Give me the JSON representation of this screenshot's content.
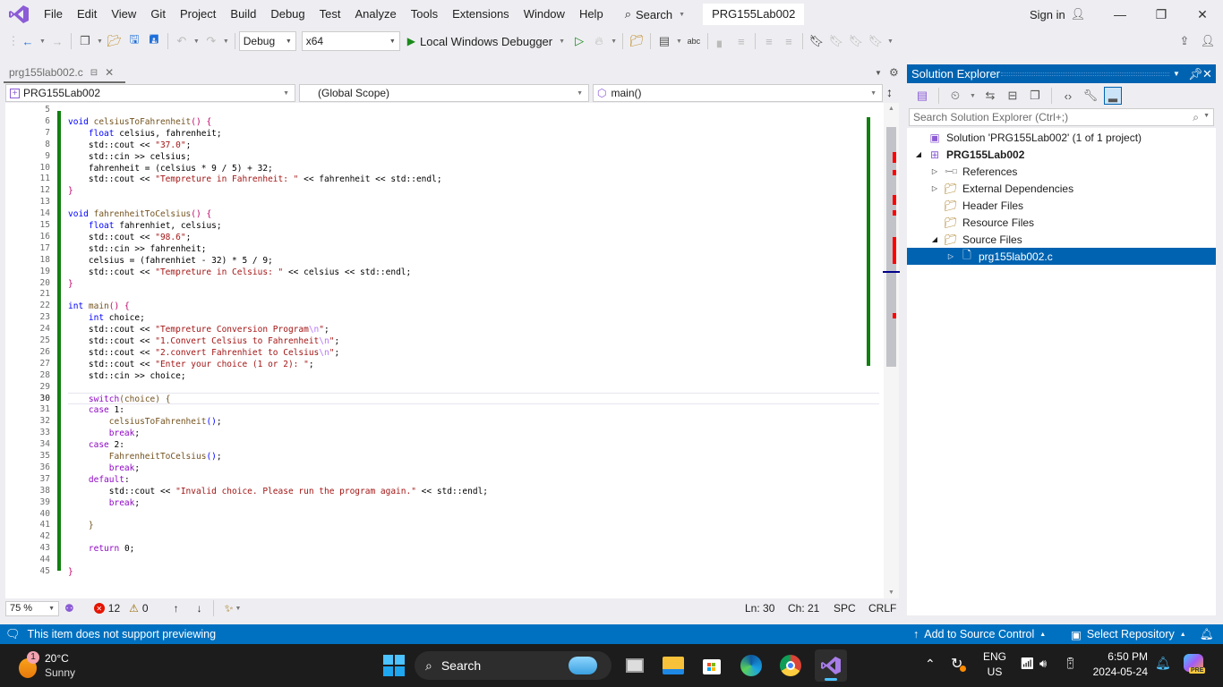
{
  "menubar": {
    "items": [
      "File",
      "Edit",
      "View",
      "Git",
      "Project",
      "Build",
      "Debug",
      "Test",
      "Analyze",
      "Tools",
      "Extensions",
      "Window",
      "Help"
    ],
    "search_label": "Search",
    "solution_title": "PRG155Lab002",
    "sign_in": "Sign in"
  },
  "toolbar": {
    "config": "Debug",
    "platform": "x64",
    "debugger": "Local Windows Debugger"
  },
  "doc_tab": {
    "filename": "prg155lab002.c"
  },
  "navbar": {
    "project": "PRG155Lab002",
    "scope": "(Global Scope)",
    "member": "main()"
  },
  "editor": {
    "current_line": 30,
    "lines": [
      {
        "n": "5",
        "tokens": []
      },
      {
        "n": "6",
        "tokens": [
          [
            "kw",
            "void "
          ],
          [
            "fn",
            "celsiusToFahrenheit"
          ],
          [
            "br",
            "() {"
          ]
        ]
      },
      {
        "n": "7",
        "tokens": [
          [
            "plain",
            "    "
          ],
          [
            "kw",
            "float "
          ],
          [
            "plain",
            "celsius, fahrenheit;"
          ]
        ]
      },
      {
        "n": "8",
        "tokens": [
          [
            "plain",
            "    std::cout << "
          ],
          [
            "str",
            "\"37.0\""
          ],
          [
            "plain",
            ";"
          ]
        ]
      },
      {
        "n": "9",
        "tokens": [
          [
            "plain",
            "    std::cin >> celsius;"
          ]
        ]
      },
      {
        "n": "10",
        "tokens": [
          [
            "plain",
            "    fahrenheit = (celsius * 9 / 5) + 32;"
          ]
        ]
      },
      {
        "n": "11",
        "tokens": [
          [
            "plain",
            "    std::cout << "
          ],
          [
            "str",
            "\"Tempreture in Fahrenheit: \""
          ],
          [
            "plain",
            " << fahrenheit << std::endl;"
          ]
        ]
      },
      {
        "n": "12",
        "tokens": [
          [
            "br",
            "}"
          ]
        ]
      },
      {
        "n": "13",
        "tokens": []
      },
      {
        "n": "14",
        "tokens": [
          [
            "kw",
            "void "
          ],
          [
            "fn",
            "fahrenheitToCelsius"
          ],
          [
            "br",
            "() {"
          ]
        ]
      },
      {
        "n": "15",
        "tokens": [
          [
            "plain",
            "    "
          ],
          [
            "kw",
            "float "
          ],
          [
            "plain",
            "fahrenhiet, celsius;"
          ]
        ]
      },
      {
        "n": "16",
        "tokens": [
          [
            "plain",
            "    std::cout << "
          ],
          [
            "str",
            "\"98.6\""
          ],
          [
            "plain",
            ";"
          ]
        ]
      },
      {
        "n": "17",
        "tokens": [
          [
            "plain",
            "    std::cin >> fahrenheit;"
          ]
        ]
      },
      {
        "n": "18",
        "tokens": [
          [
            "plain",
            "    celsius = (fahrenhiet - 32) * 5 / 9;"
          ]
        ]
      },
      {
        "n": "19",
        "tokens": [
          [
            "plain",
            "    std::cout << "
          ],
          [
            "str",
            "\"Tempreture in Celsius: \""
          ],
          [
            "plain",
            " << celsius << std::endl;"
          ]
        ]
      },
      {
        "n": "20",
        "tokens": [
          [
            "br",
            "}"
          ]
        ]
      },
      {
        "n": "21",
        "tokens": []
      },
      {
        "n": "22",
        "tokens": [
          [
            "kw",
            "int "
          ],
          [
            "fn",
            "main"
          ],
          [
            "br",
            "() {"
          ]
        ]
      },
      {
        "n": "23",
        "tokens": [
          [
            "plain",
            "    "
          ],
          [
            "kw",
            "int "
          ],
          [
            "plain",
            "choice;"
          ]
        ]
      },
      {
        "n": "24",
        "tokens": [
          [
            "plain",
            "    std::cout << "
          ],
          [
            "str",
            "\"Tempreture Conversion Program"
          ],
          [
            "esc",
            "\\n"
          ],
          [
            "str",
            "\""
          ],
          [
            "plain",
            ";"
          ]
        ]
      },
      {
        "n": "25",
        "tokens": [
          [
            "plain",
            "    std::cout << "
          ],
          [
            "str",
            "\"1.Convert Celsius to Fahrenheit"
          ],
          [
            "esc",
            "\\n"
          ],
          [
            "str",
            "\""
          ],
          [
            "plain",
            ";"
          ]
        ]
      },
      {
        "n": "26",
        "tokens": [
          [
            "plain",
            "    std::cout << "
          ],
          [
            "str",
            "\"2.convert Fahrenhiet to Celsius"
          ],
          [
            "esc",
            "\\n"
          ],
          [
            "str",
            "\""
          ],
          [
            "plain",
            ";"
          ]
        ]
      },
      {
        "n": "27",
        "tokens": [
          [
            "plain",
            "    std::cout << "
          ],
          [
            "str",
            "\"Enter your choice (1 or 2): \""
          ],
          [
            "plain",
            ";"
          ]
        ]
      },
      {
        "n": "28",
        "tokens": [
          [
            "plain",
            "    std::cin >> choice;"
          ]
        ]
      },
      {
        "n": "29",
        "tokens": []
      },
      {
        "n": "30",
        "tokens": [
          [
            "plain",
            "    "
          ],
          [
            "ctl",
            "switch"
          ],
          [
            "fn",
            "(choice) {"
          ]
        ]
      },
      {
        "n": "31",
        "tokens": [
          [
            "plain",
            "    "
          ],
          [
            "ctl",
            "case "
          ],
          [
            "plain",
            "1:"
          ]
        ]
      },
      {
        "n": "32",
        "tokens": [
          [
            "plain",
            "        "
          ],
          [
            "fn",
            "celsiusToFahrenheit"
          ],
          [
            "kw",
            "()"
          ],
          [
            "plain",
            ";"
          ]
        ]
      },
      {
        "n": "33",
        "tokens": [
          [
            "plain",
            "        "
          ],
          [
            "ctl",
            "break"
          ],
          [
            "plain",
            ";"
          ]
        ]
      },
      {
        "n": "34",
        "tokens": [
          [
            "plain",
            "    "
          ],
          [
            "ctl",
            "case "
          ],
          [
            "plain",
            "2:"
          ]
        ]
      },
      {
        "n": "35",
        "tokens": [
          [
            "plain",
            "        "
          ],
          [
            "fn",
            "FahrenheitToCelsius"
          ],
          [
            "kw",
            "()"
          ],
          [
            "plain",
            ";"
          ]
        ]
      },
      {
        "n": "36",
        "tokens": [
          [
            "plain",
            "        "
          ],
          [
            "ctl",
            "break"
          ],
          [
            "plain",
            ";"
          ]
        ]
      },
      {
        "n": "37",
        "tokens": [
          [
            "plain",
            "    "
          ],
          [
            "ctl",
            "default"
          ],
          [
            "plain",
            ":"
          ]
        ]
      },
      {
        "n": "38",
        "tokens": [
          [
            "plain",
            "        std::cout << "
          ],
          [
            "str",
            "\"Invalid choice. Please run the program again.\""
          ],
          [
            "plain",
            " << std::endl;"
          ]
        ]
      },
      {
        "n": "39",
        "tokens": [
          [
            "plain",
            "        "
          ],
          [
            "ctl",
            "break"
          ],
          [
            "plain",
            ";"
          ]
        ]
      },
      {
        "n": "40",
        "tokens": []
      },
      {
        "n": "41",
        "tokens": [
          [
            "plain",
            "    "
          ],
          [
            "fn",
            "}"
          ]
        ]
      },
      {
        "n": "42",
        "tokens": []
      },
      {
        "n": "43",
        "tokens": [
          [
            "plain",
            "    "
          ],
          [
            "ctl",
            "return "
          ],
          [
            "plain",
            "0;"
          ]
        ]
      },
      {
        "n": "44",
        "tokens": []
      },
      {
        "n": "45",
        "tokens": [
          [
            "br",
            "}"
          ]
        ]
      }
    ]
  },
  "editor_status": {
    "zoom": "75 %",
    "errors": "12",
    "warnings": "0",
    "line": "Ln: 30",
    "col": "Ch: 21",
    "whitespace": "SPC",
    "line_ending": "CRLF"
  },
  "solution_explorer": {
    "title": "Solution Explorer",
    "search_placeholder": "Search Solution Explorer (Ctrl+;)",
    "tree": [
      {
        "label": "Solution 'PRG155Lab002' (1 of 1 project)",
        "depth": 0,
        "expander": "",
        "icon": "solution-icon",
        "bold": false,
        "selected": false
      },
      {
        "label": "PRG155Lab002",
        "depth": 1,
        "expander": "expanded",
        "icon": "project-icon",
        "bold": true,
        "selected": false
      },
      {
        "label": "References",
        "depth": 2,
        "expander": "collapsed",
        "icon": "references-icon",
        "bold": false,
        "selected": false
      },
      {
        "label": "External Dependencies",
        "depth": 2,
        "expander": "collapsed",
        "icon": "external-deps-icon",
        "bold": false,
        "selected": false
      },
      {
        "label": "Header Files",
        "depth": 2,
        "expander": "",
        "icon": "filter-folder-icon",
        "bold": false,
        "selected": false
      },
      {
        "label": "Resource Files",
        "depth": 2,
        "expander": "",
        "icon": "filter-folder-icon",
        "bold": false,
        "selected": false
      },
      {
        "label": "Source Files",
        "depth": 2,
        "expander": "expanded",
        "icon": "filter-folder-icon",
        "bold": false,
        "selected": false
      },
      {
        "label": "prg155lab002.c",
        "depth": 3,
        "expander": "collapsed",
        "icon": "c-file-icon",
        "bold": false,
        "selected": true
      }
    ]
  },
  "statusbar": {
    "message": "This item does not support previewing",
    "source_control": "Add to Source Control",
    "repository": "Select Repository"
  },
  "taskbar": {
    "weather_temp": "20°C",
    "weather_desc": "Sunny",
    "weather_badge": "1",
    "search_label": "Search",
    "lang_top": "ENG",
    "lang_bottom": "US",
    "time": "6:50 PM",
    "date": "2024-05-24",
    "copilot_badge": "PRE"
  },
  "colors": {
    "accent": "#0063b1",
    "statusbar": "#0071c1",
    "vs_purple": "#8c5cd6",
    "change_margin": "#108010",
    "error_mark": "#ff0000"
  }
}
